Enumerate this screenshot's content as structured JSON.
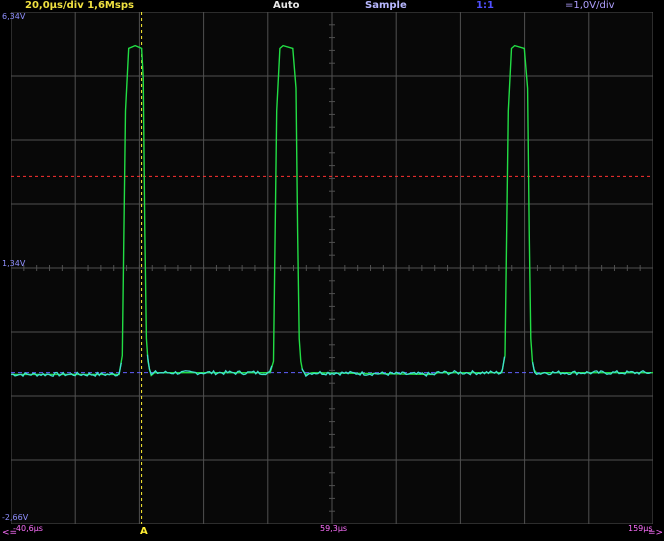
{
  "top_bar": {
    "timebase": "20,0µs/div  1,6Msps",
    "trigger_mode": "Auto",
    "acquisition_mode": "Sample",
    "probe": "1:1",
    "channel_scale": "=1,0V/div"
  },
  "y_labels": {
    "top": "6,34V",
    "middle": "1,34V",
    "bottom": "-2,66V"
  },
  "time_labels": {
    "left": "-40,6µs",
    "center": "59,3µs",
    "right": "159µs"
  },
  "trigger": {
    "marker": "A",
    "level_marker": "\\"
  },
  "nav": {
    "left": "<=",
    "right": "=>"
  },
  "colors": {
    "background": "#000000",
    "grid": "#505050",
    "trace_green": "#22dd44",
    "trace_cyan": "#40e0d0",
    "trigger_line": "#ffee33",
    "level_line": "#ff3030",
    "baseline": "#6060ff"
  },
  "chart_data": {
    "type": "line",
    "title": "",
    "xlabel": "",
    "ylabel": "",
    "x_unit": "µs",
    "y_unit": "V",
    "xlim": [
      -40.6,
      159
    ],
    "ylim": [
      -2.66,
      6.34
    ],
    "trigger_level_v": 3.45,
    "trigger_time_us": 0,
    "grid": true,
    "series": [
      {
        "name": "",
        "x": [
          -40.6,
          -7.0,
          -6.0,
          -5.0,
          -4.0,
          -2.0,
          0.0,
          0.5,
          1.0,
          1.5,
          2.0,
          2.5,
          3.0,
          4.0,
          6.0,
          40.0,
          41.0,
          42.0,
          43.0,
          44.0,
          47.0,
          48.0,
          48.5,
          49.0,
          49.5,
          50.0,
          51.0,
          53.0,
          90.0,
          91.0,
          92.0,
          93.0,
          94.0,
          97.0,
          98.0,
          98.5,
          99.0,
          99.5,
          100.0,
          101.0,
          103.0,
          112.0,
          113.0,
          114.0,
          115.0,
          116.0,
          119.0,
          120.0,
          120.5,
          121.0,
          121.5,
          122.0,
          123.0,
          125.0,
          159.0
        ],
        "y": [
          -0.03,
          -0.03,
          0.3,
          4.6,
          5.7,
          5.75,
          5.7,
          5.2,
          2.5,
          0.6,
          0.2,
          0.05,
          -0.05,
          0.0,
          0.0,
          0.0,
          0.2,
          4.6,
          5.7,
          5.75,
          5.7,
          5.0,
          2.5,
          0.6,
          0.2,
          0.05,
          -0.03,
          0.0,
          -0.03,
          -0.03,
          0.0,
          0.0,
          0.0,
          0.0,
          0.0,
          0.0,
          0.0,
          0.0,
          0.0,
          0.0,
          0.0,
          0.0,
          0.3,
          4.6,
          5.7,
          5.75,
          5.7,
          5.0,
          2.5,
          0.6,
          0.2,
          0.05,
          -0.02,
          0.0,
          0.0
        ]
      }
    ]
  }
}
